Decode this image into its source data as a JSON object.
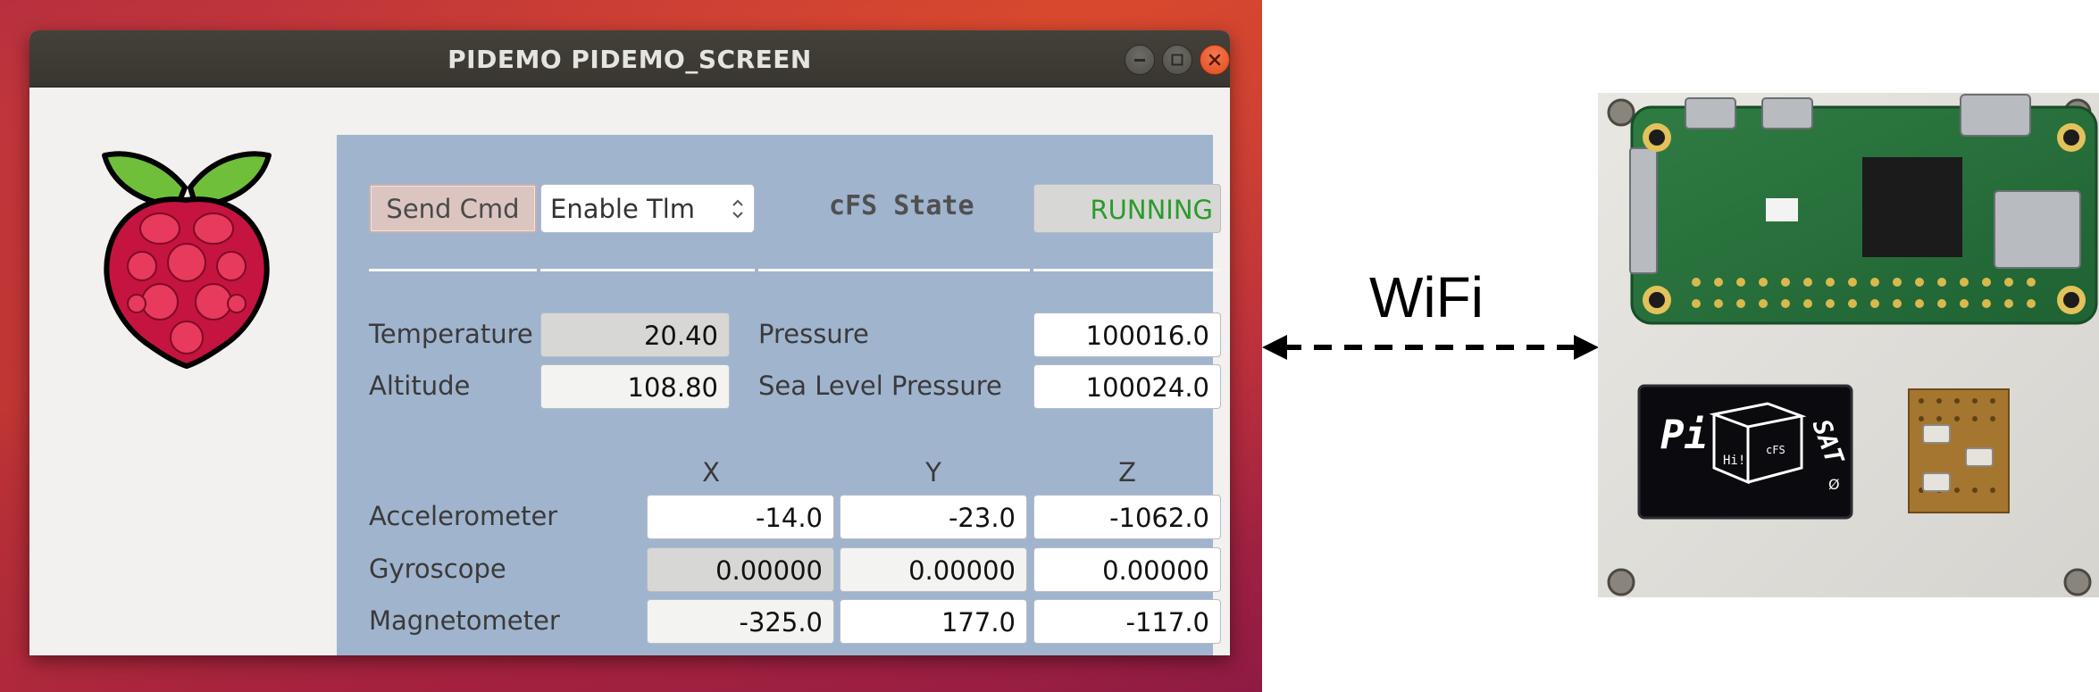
{
  "window": {
    "title": "PIDEMO PIDEMO_SCREEN"
  },
  "controls": {
    "send_cmd_label": "Send Cmd",
    "command_selected": "Enable Tlm",
    "cfs_state_label": "cFS State",
    "cfs_state_value": "RUNNING",
    "cfs_state_color": "#2a9b2a"
  },
  "environment": {
    "temperature_label": "Temperature",
    "temperature_value": "20.40",
    "altitude_label": "Altitude",
    "altitude_value": "108.80",
    "pressure_label": "Pressure",
    "pressure_value": "100016.0",
    "sea_level_pressure_label": "Sea Level Pressure",
    "sea_level_pressure_value": "100024.0"
  },
  "imu": {
    "axes": [
      "X",
      "Y",
      "Z"
    ],
    "rows": [
      {
        "label": "Accelerometer",
        "values": [
          "-14.0",
          "-23.0",
          "-1062.0"
        ]
      },
      {
        "label": "Gyroscope",
        "values": [
          "0.00000",
          "0.00000",
          "0.00000"
        ]
      },
      {
        "label": "Magnetometer",
        "values": [
          "-325.0",
          "177.0",
          "-117.0"
        ]
      }
    ]
  },
  "link": {
    "label": "WiFi"
  },
  "hardware": {
    "oled_text": [
      "Pi",
      "SAT",
      "Hi!",
      "cFS",
      "Ø"
    ]
  },
  "icons": [
    "raspberry-pi-logo",
    "minimize-icon",
    "maximize-icon",
    "close-icon",
    "select-arrows-icon",
    "bidirectional-arrow-icon"
  ]
}
